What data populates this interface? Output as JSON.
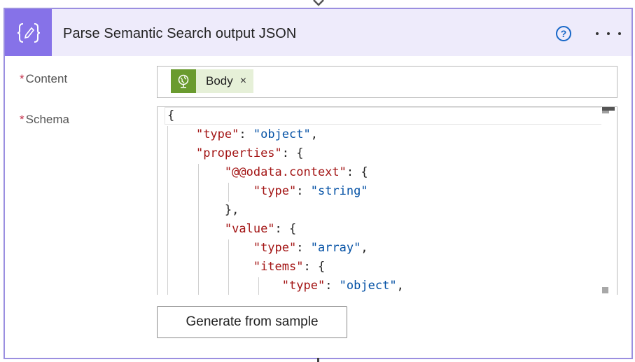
{
  "action": {
    "title": "Parse Semantic Search output JSON",
    "icon": "curly-braces-edit-icon",
    "accent_color": "#8672e8",
    "header_bg": "#eeebfb",
    "help_symbol": "?",
    "more_symbol": "..."
  },
  "content_field": {
    "required_marker": "*",
    "label": "Content",
    "token": {
      "label": "Body",
      "icon": "globe-icon",
      "remove_symbol": "×",
      "color": "#6a9b2f"
    }
  },
  "schema_field": {
    "required_marker": "*",
    "label": "Schema",
    "code_lines": [
      [
        {
          "t": "{",
          "c": "p"
        }
      ],
      [
        {
          "t": "    ",
          "c": "p"
        },
        {
          "t": "\"type\"",
          "c": "k"
        },
        {
          "t": ": ",
          "c": "p"
        },
        {
          "t": "\"object\"",
          "c": "s"
        },
        {
          "t": ",",
          "c": "p"
        }
      ],
      [
        {
          "t": "    ",
          "c": "p"
        },
        {
          "t": "\"properties\"",
          "c": "k"
        },
        {
          "t": ": {",
          "c": "p"
        }
      ],
      [
        {
          "t": "        ",
          "c": "p"
        },
        {
          "t": "\"@@odata.context\"",
          "c": "k"
        },
        {
          "t": ": {",
          "c": "p"
        }
      ],
      [
        {
          "t": "            ",
          "c": "p"
        },
        {
          "t": "\"type\"",
          "c": "k"
        },
        {
          "t": ": ",
          "c": "p"
        },
        {
          "t": "\"string\"",
          "c": "s"
        }
      ],
      [
        {
          "t": "        },",
          "c": "p"
        }
      ],
      [
        {
          "t": "        ",
          "c": "p"
        },
        {
          "t": "\"value\"",
          "c": "k"
        },
        {
          "t": ": {",
          "c": "p"
        }
      ],
      [
        {
          "t": "            ",
          "c": "p"
        },
        {
          "t": "\"type\"",
          "c": "k"
        },
        {
          "t": ": ",
          "c": "p"
        },
        {
          "t": "\"array\"",
          "c": "s"
        },
        {
          "t": ",",
          "c": "p"
        }
      ],
      [
        {
          "t": "            ",
          "c": "p"
        },
        {
          "t": "\"items\"",
          "c": "k"
        },
        {
          "t": ": {",
          "c": "p"
        }
      ],
      [
        {
          "t": "                ",
          "c": "p"
        },
        {
          "t": "\"type\"",
          "c": "k"
        },
        {
          "t": ": ",
          "c": "p"
        },
        {
          "t": "\"object\"",
          "c": "s"
        },
        {
          "t": ",",
          "c": "p"
        }
      ]
    ]
  },
  "generate_button": {
    "label": "Generate from sample"
  }
}
